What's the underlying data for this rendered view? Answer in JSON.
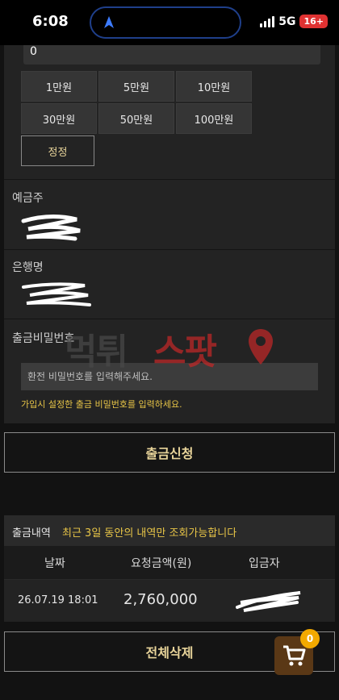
{
  "status_bar": {
    "time": "6:08",
    "network": "5G",
    "battery": "16+"
  },
  "form": {
    "amount_value": "0",
    "amount_buttons": [
      "1만원",
      "5만원",
      "10만원",
      "30만원",
      "50만원",
      "100만원"
    ],
    "reset_label": "정정",
    "depositor_label": "예금주",
    "bank_label": "은행명",
    "password_label": "출금비밀번호",
    "password_placeholder": "환전 비밀번호를 입력해주세요.",
    "password_help": "가입시 설정한 출금 비밀번호를 입력하세요."
  },
  "watermark": {
    "text_left": "먹튀",
    "text_right": "스팟"
  },
  "submit_label": "출금신청",
  "history": {
    "title": "출금내역",
    "note": "최근 3일 동안의 내역만 조회가능합니다",
    "columns": [
      "날짜",
      "요청금액(원)",
      "입금자"
    ],
    "rows": [
      {
        "date": "26.07.19 18:01",
        "amount": "2,760,000"
      }
    ]
  },
  "delete_all_label": "전체삭제",
  "cart": {
    "count": "0"
  },
  "colors": {
    "accent_gold": "#e8c547",
    "button_gold": "#e8d49a",
    "panel": "#232323",
    "watermark_red": "#c62828"
  }
}
